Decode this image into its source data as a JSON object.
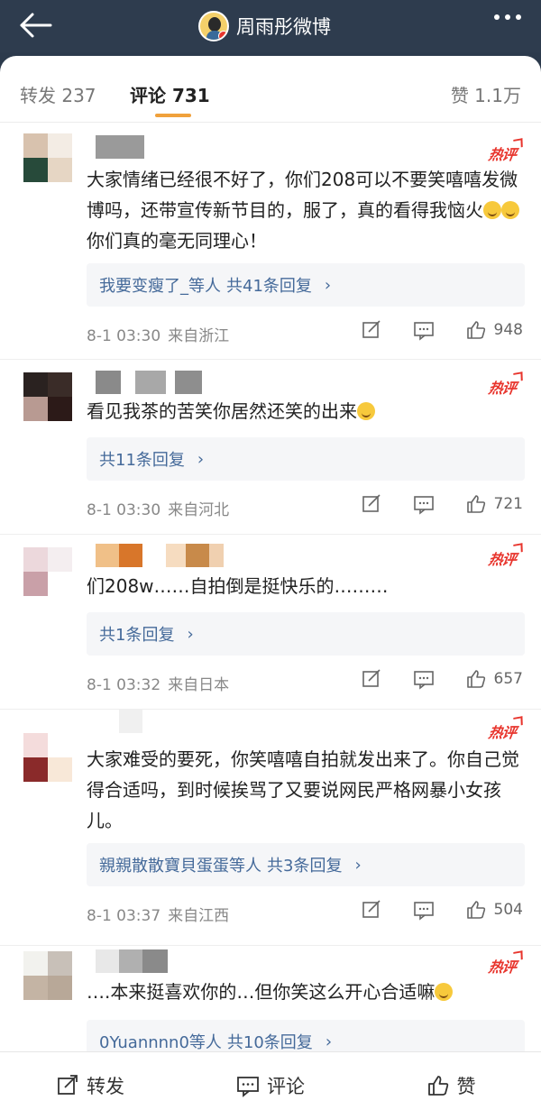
{
  "header": {
    "title": "周雨彤微博",
    "back_icon": "arrow-left-icon",
    "more_icon": "more-dots-icon"
  },
  "tabs": {
    "repost": "转发 237",
    "comments": "评论 731",
    "likes": "赞 1.1万"
  },
  "hot_label": "热评",
  "comments": [
    {
      "text_parts": [
        "大家情绪已经很不好了，你们208可以不要笑嘻嘻发微博吗，还带宣传新节目的，服了，真的看得我恼火",
        "你们真的毫无同理心！"
      ],
      "reply_names": "我要变瘦了_等人",
      "reply_count": "共41条回复",
      "time": "8-1 03:30",
      "location": "来自浙江",
      "likes": "948"
    },
    {
      "text_parts": [
        "看见我茶的苦笑你居然还笑的出来"
      ],
      "reply_names": "",
      "reply_count": "共11条回复",
      "time": "8-1 03:30",
      "location": "来自河北",
      "likes": "721"
    },
    {
      "text_parts": [
        "们208w……自拍倒是挺快乐的………"
      ],
      "reply_names": "",
      "reply_count": "共1条回复",
      "time": "8-1 03:32",
      "location": "来自日本",
      "likes": "657"
    },
    {
      "text_parts": [
        "大家难受的要死，你笑嘻嘻自拍就发出来了。你自己觉得合适吗，到时候挨骂了又要说网民严格网暴小女孩儿。"
      ],
      "reply_names": "親親散散寶貝蛋蛋等人",
      "reply_count": "共3条回复",
      "time": "8-1 03:37",
      "location": "来自江西",
      "likes": "504"
    },
    {
      "text_parts": [
        "….本来挺喜欢你的…但你笑这么开心合适嘛"
      ],
      "reply_names": "0Yuannnn0等人",
      "reply_count": "共10条回复",
      "time": "",
      "location": "",
      "likes": ""
    }
  ],
  "bottom_bar": {
    "repost": "转发",
    "comment": "评论",
    "like": "赞"
  }
}
